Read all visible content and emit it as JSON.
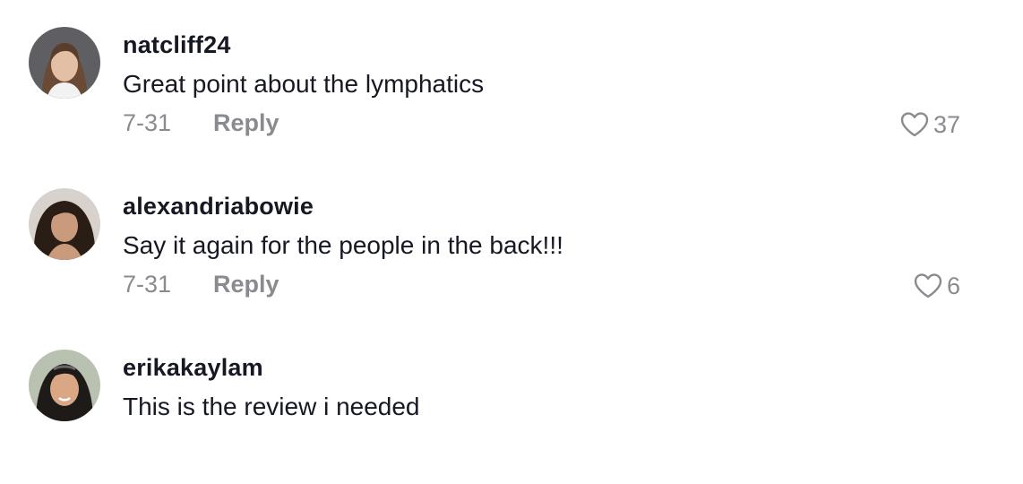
{
  "comments": [
    {
      "username": "natcliff24",
      "text": "Great point about the lymphatics",
      "date": "7-31",
      "reply_label": "Reply",
      "like_count": "37",
      "avatar_icon": "avatar-photo"
    },
    {
      "username": "alexandriabowie",
      "text": "Say it again for the people in the back!!!",
      "date": "7-31",
      "reply_label": "Reply",
      "like_count": "6",
      "avatar_icon": "avatar-photo"
    },
    {
      "username": "erikakaylam",
      "text": "This is the review i needed",
      "avatar_icon": "avatar-photo"
    }
  ],
  "colors": {
    "primary_text": "#161823",
    "secondary_text": "#8a8b91"
  },
  "icons": {
    "like": "heart-outline-icon"
  }
}
